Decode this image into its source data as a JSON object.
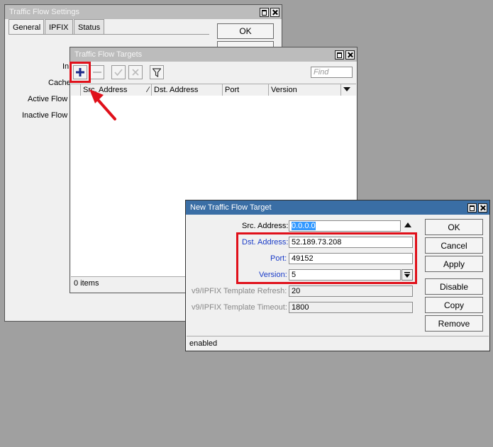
{
  "settings_window": {
    "title": "Traffic Flow Settings",
    "tabs": [
      {
        "label": "General"
      },
      {
        "label": "IPFIX"
      },
      {
        "label": "Status"
      }
    ],
    "ok_label": "OK",
    "field_labels": [
      "In",
      "Cache",
      "Active Flow",
      "Inactive Flow"
    ]
  },
  "targets_window": {
    "title": "Traffic Flow Targets",
    "find_placeholder": "Find",
    "columns": [
      "Src. Address",
      "Dst. Address",
      "Port",
      "Version"
    ],
    "status": "0 items"
  },
  "new_target_window": {
    "title": "New Traffic Flow Target",
    "fields": {
      "src_address": {
        "label": "Src. Address:",
        "value": "0.0.0.0"
      },
      "dst_address": {
        "label": "Dst. Address:",
        "value": "52.189.73.208"
      },
      "port": {
        "label": "Port:",
        "value": "49152"
      },
      "version": {
        "label": "Version:",
        "value": "5"
      },
      "template_refresh": {
        "label": "v9/IPFIX Template Refresh:",
        "value": "20"
      },
      "template_timeout": {
        "label": "v9/IPFIX Template Timeout:",
        "value": "1800"
      }
    },
    "buttons": {
      "ok": "OK",
      "cancel": "Cancel",
      "apply": "Apply",
      "disable": "Disable",
      "copy": "Copy",
      "remove": "Remove"
    },
    "status": "enabled"
  },
  "colors": {
    "highlight_red": "#e0101a",
    "active_title": "#3a6ea5",
    "label_blue": "#1a3cc8"
  }
}
